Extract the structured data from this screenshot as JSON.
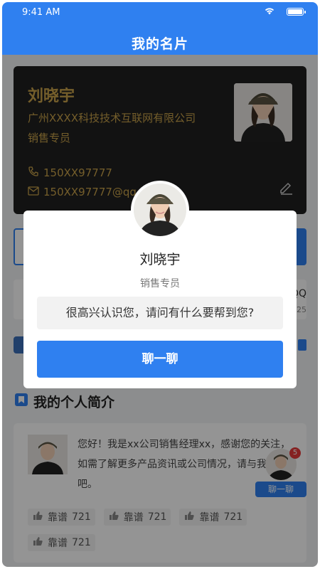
{
  "status_bar": {
    "time": "9:41 AM"
  },
  "header": {
    "title": "我的名片"
  },
  "card": {
    "name": "刘晓宇",
    "company": "广州XXXX科技技术互联网有限公司",
    "role": "销售专员",
    "phone": "150XX97777",
    "email": "150XX97777@qq",
    "accent": "#c9a24a"
  },
  "info_row": {
    "partial_a": "QQ",
    "partial_b": "4525"
  },
  "intro": {
    "title": "我的个人简介",
    "text": "您好！我是xx公司销售经理xx，感谢您的关注，如需了解更多产品资讯或公司情况，请与我联系吧。",
    "likes": [
      {
        "label": "靠谱",
        "count": "721"
      },
      {
        "label": "靠谱",
        "count": "721"
      },
      {
        "label": "靠谱",
        "count": "721"
      },
      {
        "label": "靠谱",
        "count": "721"
      }
    ]
  },
  "floating_chat": {
    "badge": "5",
    "label": "聊一聊"
  },
  "dialog": {
    "name": "刘晓宇",
    "role": "销售专员",
    "greeting": "很高兴认识您，请问有什么要帮到您?",
    "chat_button": "聊一聊"
  },
  "colors": {
    "primary": "#2f80f0",
    "badge": "#e63b3b",
    "card_bg": "#1f1f1f"
  }
}
